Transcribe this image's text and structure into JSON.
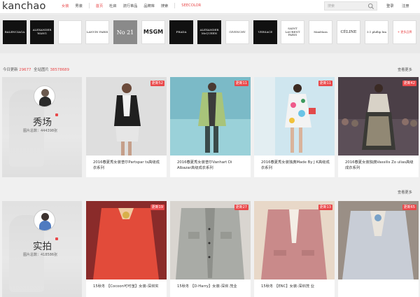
{
  "header": {
    "logo": "kanchao",
    "nav": [
      "女装",
      "男装",
      "首页",
      "杜启",
      "流行单品",
      "品牌库",
      "搜索",
      "SEECOLOR"
    ],
    "search_placeholder": "搜索",
    "login": "登录",
    "register": "注册"
  },
  "brands": [
    {
      "text": "BALENCIAGA",
      "style": "dark"
    },
    {
      "text": "ALEXANDER WANG",
      "style": "dark"
    },
    {
      "text": "",
      "style": "light"
    },
    {
      "text": "LANVIN PARIS",
      "style": "light"
    },
    {
      "text": "No 21",
      "style": "grey"
    },
    {
      "text": "MSGM",
      "style": "light"
    },
    {
      "text": "PRADA",
      "style": "dark"
    },
    {
      "text": "ALEXANDER McQUEEN",
      "style": "dark"
    },
    {
      "text": "GIVENCHY",
      "style": "light"
    },
    {
      "text": "VERSACE",
      "style": "dark"
    },
    {
      "text": "SAINT LAURENT PARIS",
      "style": "light"
    },
    {
      "text": "MaxMara",
      "style": "light"
    },
    {
      "text": "CÉLINE",
      "style": "light"
    },
    {
      "text": "3.1 phillip lim",
      "style": "light"
    },
    {
      "text": "+ 更多品牌",
      "style": "more"
    }
  ],
  "stats": {
    "today_label": "今日更新",
    "today_value": "29677",
    "total_label": "全站图片",
    "total_value": "38578689"
  },
  "sections": [
    {
      "more": "查看更多",
      "category": {
        "name": "秀场",
        "count": "图片总数：444398张"
      },
      "items": [
        {
          "tag": "更新52",
          "caption": "2016春夏秀女装普尔Partspar ts高级成衣系列"
        },
        {
          "tag": "更新11",
          "caption": "2016春夏秀女装普尔Vanhart Di Albazar高级成衣系列"
        },
        {
          "tag": "更新11",
          "caption": "2016春夏秀女装独典Made By J K高级成衣系列"
        },
        {
          "tag": "更新42",
          "caption": "2016春夏女装独典Vassilis Zo ulias高级成衣系列"
        }
      ]
    },
    {
      "more": "查看更多",
      "category": {
        "name": "实拍",
        "count": "图片总数：418586张"
      },
      "items": [
        {
          "tag": "更新19",
          "caption": "15秋冬 【Cocoon可可茧】女装-深圳实"
        },
        {
          "tag": "更新27",
          "caption": "15秋冬 【D-Harry】女装-深圳 茂业"
        },
        {
          "tag": "更新13",
          "caption": "15秋冬 【ENC】女装-深圳茂 业"
        },
        {
          "tag": "更新65",
          "caption": ""
        }
      ]
    }
  ]
}
